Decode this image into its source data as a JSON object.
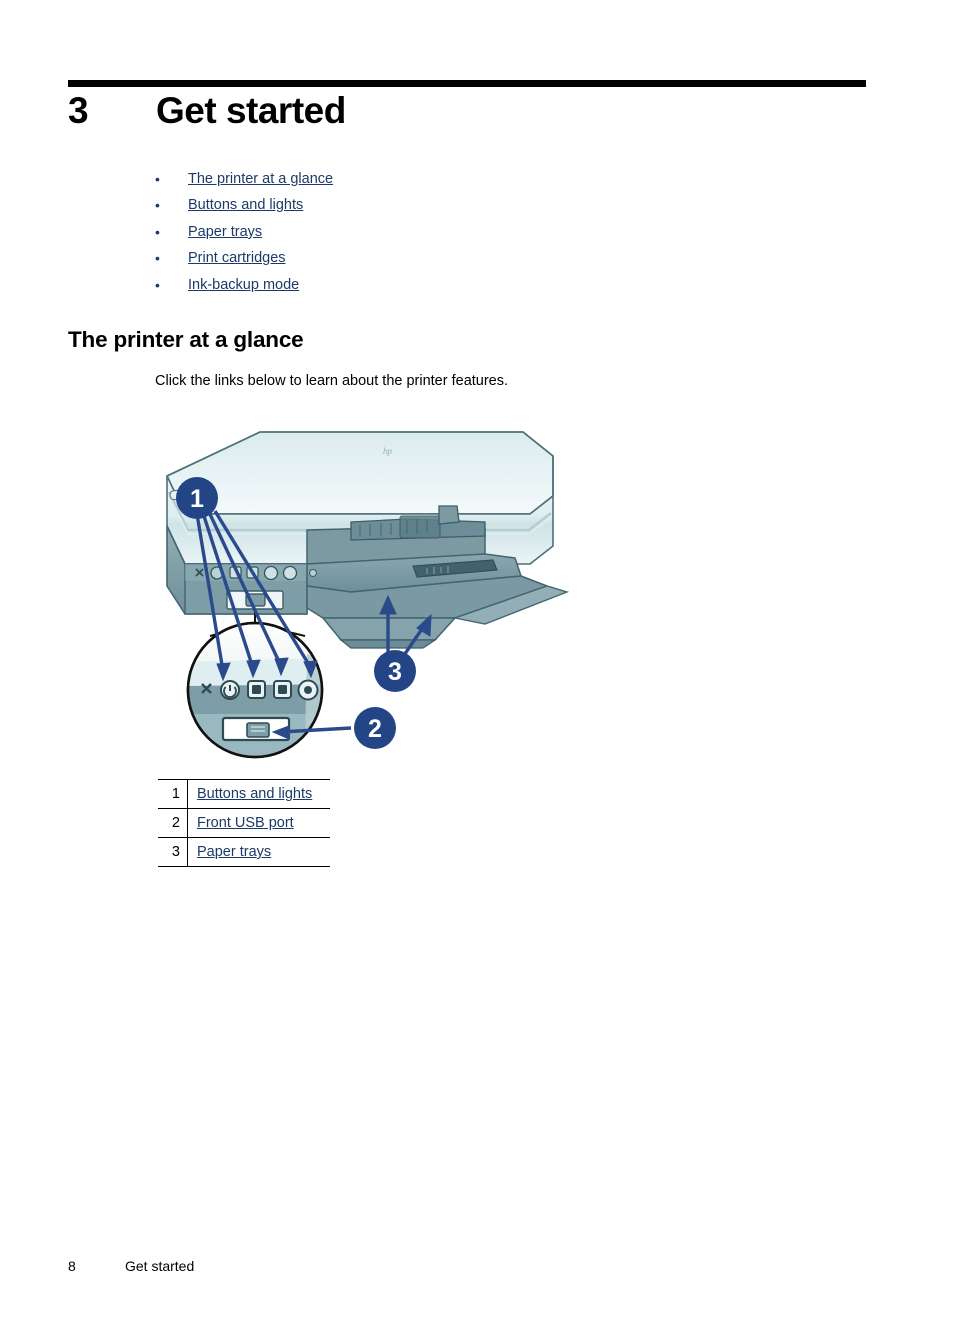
{
  "chapter": {
    "number": "3",
    "title": "Get started"
  },
  "toc": {
    "bullet_glyph": "•",
    "items": [
      {
        "label": "The printer at a glance"
      },
      {
        "label": "Buttons and lights"
      },
      {
        "label": "Paper trays"
      },
      {
        "label": "Print cartridges"
      },
      {
        "label": "Ink-backup mode"
      }
    ]
  },
  "section": {
    "title": "The printer at a glance",
    "body": "Click the links below to learn about the printer features."
  },
  "illustration": {
    "name": "hp-deskjet-printer-front-view",
    "callouts": [
      {
        "id": "1",
        "label": "1"
      },
      {
        "id": "2",
        "label": "2"
      },
      {
        "id": "3",
        "label": "3"
      }
    ],
    "hp_logo": "hp",
    "colors": {
      "callout_badge": "#234585",
      "arrow": "#2b4a8b",
      "printer_lid_light": "#e3eef0",
      "printer_lid_mid": "#c9dde0",
      "printer_body": "#7f9fa8",
      "printer_body_dark": "#5d7d87",
      "tray": "#7d9aa3",
      "outline": "#3d5c66"
    }
  },
  "legend": {
    "rows": [
      {
        "num": "1",
        "label": "Buttons and lights"
      },
      {
        "num": "2",
        "label": "Front USB port"
      },
      {
        "num": "3",
        "label": "Paper trays"
      }
    ]
  },
  "footer": {
    "page_number": "8",
    "chapter_name": "Get started"
  },
  "colors": {
    "link": "#1d3a66",
    "rule": "#000000",
    "text": "#000000"
  }
}
